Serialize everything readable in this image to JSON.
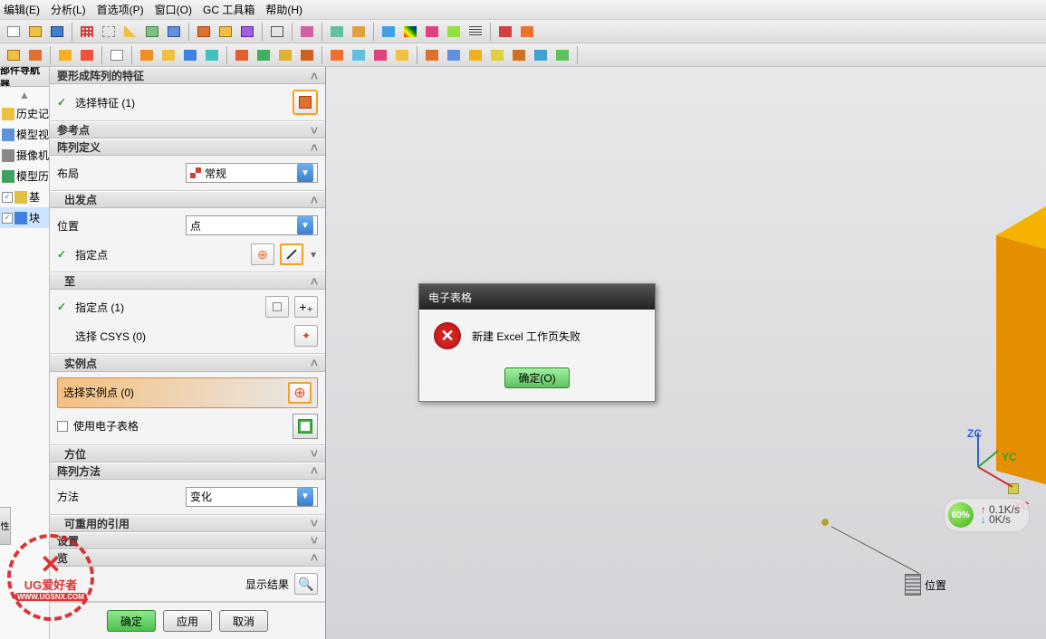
{
  "menu": {
    "edit": "编辑(E)",
    "analyze": "分析(L)",
    "preferences": "首选项(P)",
    "window": "窗口(O)",
    "gc": "GC 工具箱",
    "help": "帮助(H)"
  },
  "navigator": {
    "title": "部件导航器",
    "items": [
      "历史记录",
      "模型视图",
      "摄像机",
      "模型历史"
    ],
    "tree_base": "基",
    "tree_block": "块"
  },
  "panel": {
    "pattern_features": {
      "title": "要形成阵列的特征",
      "select": "选择特征 (1)"
    },
    "ref_point": {
      "title": "参考点"
    },
    "pattern_def": {
      "title": "阵列定义"
    },
    "layout": {
      "label": "布局",
      "value": "常规"
    },
    "start": {
      "title": "出发点",
      "position_label": "位置",
      "position_value": "点",
      "specify_point": "指定点"
    },
    "to": {
      "title": "至",
      "specify_point": "指定点 (1)",
      "select_csys": "选择 CSYS (0)"
    },
    "instance": {
      "title": "实例点",
      "select": "选择实例点 (0)",
      "use_sheet": "使用电子表格"
    },
    "orientation": {
      "title": "方位"
    },
    "pattern_method": {
      "title": "阵列方法",
      "method_label": "方法",
      "method_value": "变化"
    },
    "reusable": {
      "title": "可重用的引用"
    },
    "settings": {
      "title": "设置"
    },
    "preview": {
      "title": "览",
      "show_result": "显示结果"
    },
    "buttons": {
      "ok": "确定",
      "apply": "应用",
      "cancel": "取消"
    }
  },
  "dialog": {
    "title": "电子表格",
    "message": "新建 Excel 工作页失败",
    "ok": "确定(O)"
  },
  "viewport": {
    "axes": {
      "x": "XC",
      "y": "YC",
      "z": "ZC"
    },
    "position_label": "位置"
  },
  "speed": {
    "percent": "60%",
    "up": "0.1K/s",
    "down": "0K/s"
  },
  "watermark": {
    "brand": "UG爱好者",
    "url": "WWW.UGSNX.COM"
  },
  "left_tabs": {
    "t1": "性"
  }
}
